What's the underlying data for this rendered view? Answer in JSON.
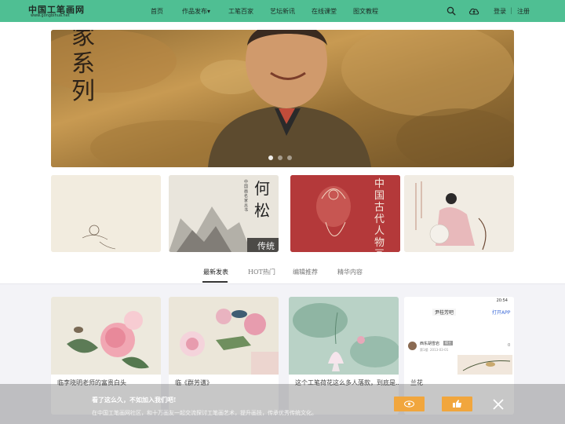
{
  "header": {
    "logo_text": "中国工笔画网",
    "logo_url_text": "www.gongbihua.net",
    "nav": [
      "首页",
      "作品发布▾",
      "工笔百家",
      "艺坛新讯",
      "在线课堂",
      "图文教程"
    ],
    "login": "登录",
    "separator": "|",
    "register": "注册",
    "search_icon": "search-icon",
    "upload_icon": "cloud-upload-icon"
  },
  "banner": {
    "overlay_text": "百家系列",
    "slide_count": 3,
    "active_slide": 1
  },
  "tabs": {
    "items": [
      "最新发表",
      "HOT热门",
      "编辑推荐",
      "精华内容"
    ],
    "active": 0
  },
  "thumbnails": [
    {
      "text": ""
    },
    {
      "text": "何松",
      "side_text": "中国画名家丛书",
      "corner_text": "传统"
    },
    {
      "text": "中国古代人物画"
    },
    {
      "text": ""
    }
  ],
  "cards": [
    {
      "title": "临李晓明老师的富贵白头"
    },
    {
      "title": "临《群芳谱》"
    },
    {
      "title": "这个工笔荷花这么多人落款，到底是..."
    },
    {
      "title": "兰花",
      "app": {
        "time": "20:54",
        "group": "尹桂芳吧",
        "open": "打开APP",
        "user": "西东胡雪岩",
        "badge": "楼主",
        "floor": "第1楼",
        "date": "2013-03-01",
        "likes": "0"
      }
    }
  ],
  "toast": {
    "title": "看了这么久，不如加入我们吧!",
    "subtitle": "在中国工笔画网社区，和十万画友一起交流探讨工笔画艺术，提升画技，传承优秀传统文化。",
    "close_icon": "close-icon"
  },
  "colors": {
    "header": "#4fbf93",
    "accent": "#f1a63d"
  }
}
